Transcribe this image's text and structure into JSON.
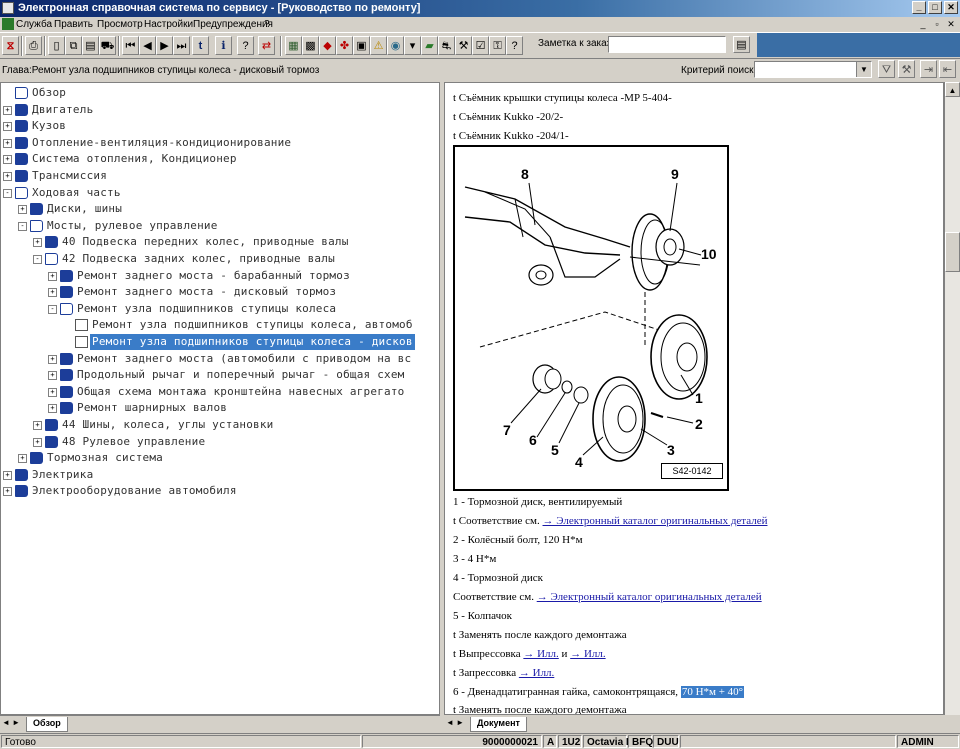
{
  "window": {
    "title": "Электронная справочная система по сервису - [Руководство по ремонту]",
    "controls": [
      "_",
      "□",
      "✕"
    ]
  },
  "menu": {
    "items": [
      "Служба",
      "Править",
      "Просмотр",
      "Настройки",
      "Предупреждения",
      "?"
    ],
    "mdi_controls": [
      "_",
      "▫",
      "✕"
    ]
  },
  "toolbar": {
    "order_note_label": "Заметка к заказу:",
    "order_note_value": ""
  },
  "infobar": {
    "chapter": "Глава:Ремонт узла подшипников ступицы колеса - дисковый тормоз",
    "criterion_label": "Критерий поиска:",
    "criterion_value": ""
  },
  "tree": {
    "items": [
      {
        "label": "Обзор",
        "level": 0,
        "icon": "book-open-icon",
        "expander": ""
      },
      {
        "label": "Двигатель",
        "level": 0,
        "icon": "book-icon",
        "expander": "+"
      },
      {
        "label": "Кузов",
        "level": 0,
        "icon": "book-icon",
        "expander": "+"
      },
      {
        "label": "Отопление-вентиляция-кондиционирование",
        "level": 0,
        "icon": "book-icon",
        "expander": "+"
      },
      {
        "label": "Система отопления, Кондиционер",
        "level": 0,
        "icon": "book-icon",
        "expander": "+"
      },
      {
        "label": "Трансмиссия",
        "level": 0,
        "icon": "book-icon",
        "expander": "+"
      },
      {
        "label": "Ходовая часть",
        "level": 0,
        "icon": "book-open-icon",
        "expander": "-"
      },
      {
        "label": "Диски, шины",
        "level": 1,
        "icon": "book-icon",
        "expander": "+"
      },
      {
        "label": "Мосты, рулевое управление",
        "level": 1,
        "icon": "book-open-icon",
        "expander": "-"
      },
      {
        "label": "40 Подвеска передних колес, приводные валы",
        "level": 2,
        "icon": "book-icon",
        "expander": "+"
      },
      {
        "label": "42 Подвеска задних колес, приводные валы",
        "level": 2,
        "icon": "book-open-icon",
        "expander": "-"
      },
      {
        "label": "Ремонт заднего моста - барабанный тормоз",
        "level": 3,
        "icon": "book-icon",
        "expander": "+"
      },
      {
        "label": "Ремонт заднего моста - дисковый тормоз",
        "level": 3,
        "icon": "book-icon",
        "expander": "+"
      },
      {
        "label": "Ремонт узла подшипников ступицы колеса",
        "level": 3,
        "icon": "book-open-icon",
        "expander": "-"
      },
      {
        "label": "Ремонт узла подшипников ступицы колеса, автомоб",
        "level": 4,
        "icon": "doc-icon",
        "expander": ""
      },
      {
        "label": "Ремонт узла подшипников ступицы колеса - дисков",
        "level": 4,
        "icon": "doc-icon",
        "expander": "",
        "selected": true
      },
      {
        "label": "Ремонт заднего моста (автомобили с приводом на вс",
        "level": 3,
        "icon": "book-icon",
        "expander": "+"
      },
      {
        "label": "Продольный рычаг и поперечный рычаг - общая схем",
        "level": 3,
        "icon": "book-icon",
        "expander": "+"
      },
      {
        "label": "Общая схема монтажа кронштейна навесных агрегато",
        "level": 3,
        "icon": "book-icon",
        "expander": "+"
      },
      {
        "label": "Ремонт шарнирных валов",
        "level": 3,
        "icon": "book-icon",
        "expander": "+"
      },
      {
        "label": "44 Шины, колеса, углы установки",
        "level": 2,
        "icon": "book-icon",
        "expander": "+"
      },
      {
        "label": "48 Рулевое управление",
        "level": 2,
        "icon": "book-icon",
        "expander": "+"
      },
      {
        "label": "Тормозная система",
        "level": 1,
        "icon": "book-icon",
        "expander": "+"
      },
      {
        "label": "Электрика",
        "level": 0,
        "icon": "book-icon",
        "expander": "+"
      },
      {
        "label": "Электрооборудование автомобиля",
        "level": 0,
        "icon": "book-icon",
        "expander": "+"
      }
    ]
  },
  "left_tabs": {
    "nav": "◄ ►",
    "active": "Обзор"
  },
  "right_tabs": {
    "nav": "◄ ►",
    "active": "Документ"
  },
  "document": {
    "tools": [
      "t  Съёмник крышки ступицы колеса -MP 5-404-",
      "t  Съёмник Kukko -20/2-",
      "t  Съёмник Kukko -204/1-"
    ],
    "figure": {
      "ref": "S42-0142",
      "callouts": [
        "1",
        "2",
        "3",
        "4",
        "5",
        "6",
        "7",
        "8",
        "9",
        "10"
      ]
    },
    "item1": "1 -  Тормозной диск, вентилируемый",
    "item1_ref_prefix": "t  Соответствие см. ",
    "catalog_link": "→ Электронный каталог оригинальных деталей",
    "item2": "2 -  Колёсный болт, 120 Н*м",
    "item3": "3 -  4 Н*м",
    "item4": "4 -  Тормозной диск",
    "item4_ref_prefix": "Соответствие см. ",
    "item5": "5 -  Колпачок",
    "item5_note": "t  Заменять после каждого демонтажа",
    "press_out_prefix": "t  Выпрессовка ",
    "ill_link": "→ Илл.",
    "and": " и ",
    "press_in_prefix": "t  Запрессовка ",
    "item6": "6 -  Двенадцатигранная гайка, самоконтрящаяся, ",
    "item6_torque": "70 Н*м + 40°",
    "item6_note": "t  Заменять после каждого демонтажа"
  },
  "status": {
    "ready": "Готово",
    "code": "9000000021",
    "fields": [
      "A",
      "1U2",
      "Octavia I",
      "BFQ",
      "DUU"
    ],
    "user": "ADMIN"
  }
}
